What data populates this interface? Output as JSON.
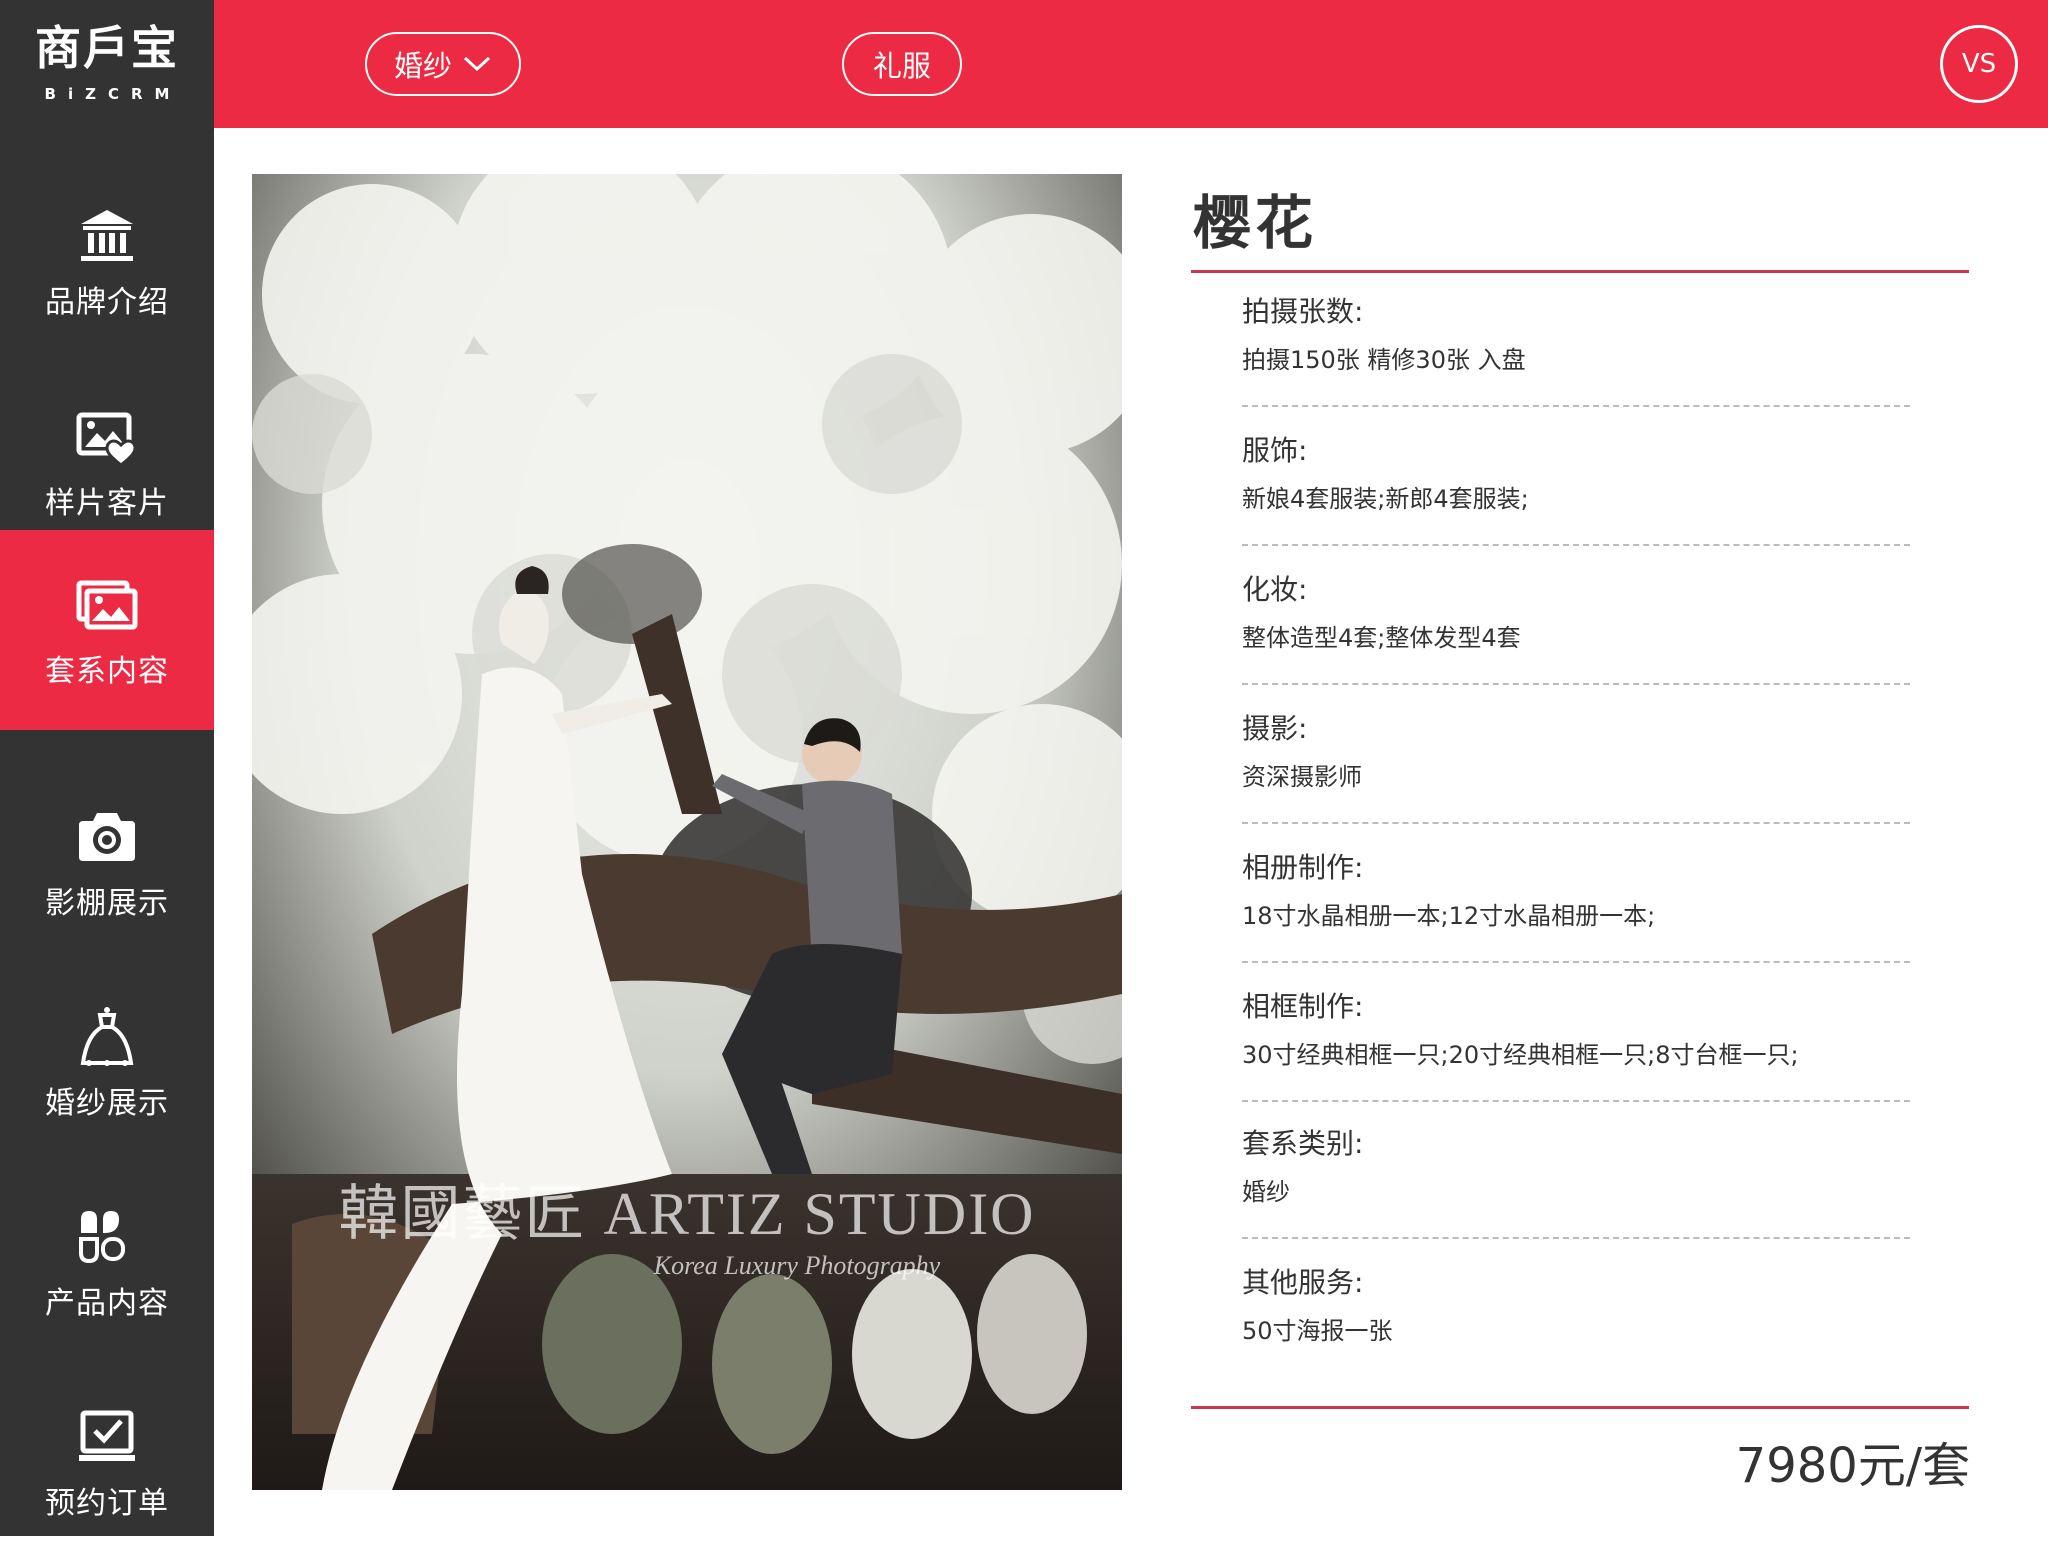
{
  "logo": {
    "main": "商戶宝",
    "sub": "BiZCRM"
  },
  "sidebar": {
    "items": [
      {
        "label": "品牌介绍",
        "icon": "bank-icon",
        "active": false
      },
      {
        "label": "样片客片",
        "icon": "photo-heart-icon",
        "active": false
      },
      {
        "label": "套系内容",
        "icon": "gallery-icon",
        "active": true
      },
      {
        "label": "影棚展示",
        "icon": "camera-icon",
        "active": false
      },
      {
        "label": "婚纱展示",
        "icon": "wedding-dress-icon",
        "active": false
      },
      {
        "label": "产品内容",
        "icon": "apps-icon",
        "active": false
      },
      {
        "label": "预约订单",
        "icon": "order-check-icon",
        "active": false
      }
    ]
  },
  "topbar": {
    "dress_tab": "婚纱",
    "gown_tab": "礼服",
    "vs_label": "VS"
  },
  "colors": {
    "accent": "#ec2a43",
    "sidebar": "#333333",
    "rule": "#c8374d"
  },
  "package": {
    "title": "樱花",
    "price": "7980元/套",
    "specs": [
      {
        "name": "拍摄张数:",
        "value": "拍摄150张 精修30张 入盘"
      },
      {
        "name": "服饰:",
        "value": "新娘4套服装;新郎4套服装;"
      },
      {
        "name": "化妆:",
        "value": " 整体造型4套;整体发型4套"
      },
      {
        "name": "摄影:",
        "value": "资深摄影师"
      },
      {
        "name": "相册制作:",
        "value": "18寸水晶相册一本;12寸水晶相册一本;"
      },
      {
        "name": "相框制作:",
        "value": "30寸经典相框一只;20寸经典相框一只;8寸台框一只;"
      },
      {
        "name": "套系类别:",
        "value": "婚纱"
      },
      {
        "name": "其他服务:",
        "value": "50寸海报一张"
      }
    ]
  },
  "photo": {
    "watermark_main": "韓國藝匠 ARTIZ STUDIO",
    "watermark_sub": "Korea Luxury Photography"
  }
}
